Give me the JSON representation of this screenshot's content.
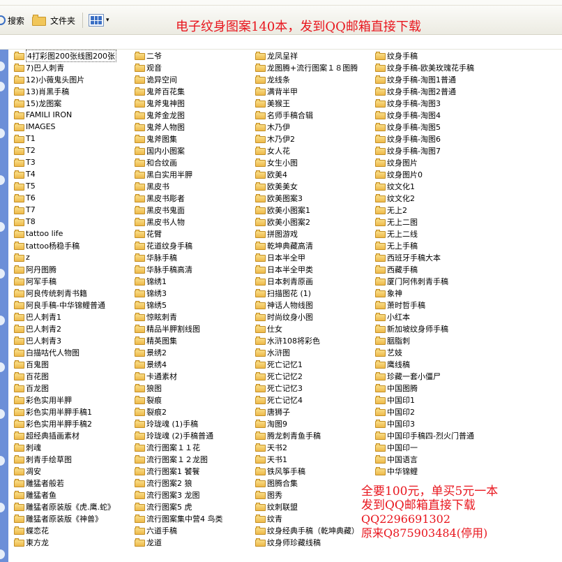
{
  "toolbar": {
    "search_label": "搜索",
    "folders_label": "文件夹",
    "banner_text": "电子纹身图案140本，发到QQ邮箱直接下载"
  },
  "promo": {
    "line1": "全要100元，单买5元一本",
    "line2": "发到QQ邮箱直接下载",
    "line3": "QQ2296691302",
    "line4": "原来Q875903484(停用)"
  },
  "colors": {
    "banner": "#e8161e",
    "sidebar": "#6c8fd8"
  },
  "files": {
    "col1": [
      "4打彩图200张线图200张",
      "7)巴人刺青",
      "12)小薇鬼头图片",
      "13)肖黑手稿",
      "15)龙图案",
      "FAMILI IRON",
      "IMAGES",
      "T1",
      "T2",
      "T3",
      "T4",
      "T5",
      "T6",
      "T7",
      "T8",
      "tattoo life",
      "tattoo杨稳手稿",
      "z",
      "阿丹图腾",
      "阿军手稿",
      "阿良传统刺青书籍",
      "阿良手稿-中华锦鲤普通",
      "巴人刺青1",
      "巴人刺青2",
      "巴人刺青3",
      "白描咕代人物图",
      "百鬼图",
      "百花图",
      "百龙图",
      "彩色实用半胛",
      "彩色实用半胛手稿1",
      "彩色实用半胛手稿2",
      "超经典插画素材",
      "刺魂",
      "刺青手绘草图",
      "凋安",
      "雕猛者般若",
      "雕猛者鱼",
      "雕猛者原装版《虎.鹰.蛇》",
      "雕猛者原装版《神兽》",
      "蝶恋花",
      "東方龙"
    ],
    "col2": [
      "二爷",
      "观音",
      "诡异空间",
      "鬼斧百花集",
      "鬼斧鬼神图",
      "鬼斧金龙图",
      "鬼斧人物图",
      "鬼斧图集",
      "国内小图案",
      "和合纹画",
      "黑白实用半胛",
      "黑皮书",
      "黑皮书彫者",
      "黑皮书鬼面",
      "黑皮书人物",
      "花臂",
      "花道纹身手稿",
      "华脉手稿",
      "华脉手稿高清",
      "锦绣1",
      "锦绣3",
      "锦绣5",
      "惊眩刺青",
      "精品半胛割线图",
      "精英图集",
      "景绣2",
      "景绣4",
      "卡通素材",
      "狼图",
      "裂痕",
      "裂痕2",
      "玲珑魂 (1)手稿",
      "玲珑魂 (2)手稿普通",
      "流行图案１１花",
      "流行图案１２龙图",
      "流行图案1 饕餮",
      "流行图案2 狼",
      "流行图案3 龙图",
      "流行图案5 虎",
      "流行图案集中营4 鸟类",
      "六道手稿",
      "龙道"
    ],
    "col3": [
      "龙凤呈祥",
      "龙图腾+流行图案１８图腾",
      "龙线条",
      "满背半甲",
      "美猴王",
      "名师手稿合辑",
      "木乃伊",
      "木乃伊2",
      "女人花",
      "女生小图",
      "欧美4",
      "欧美美女",
      "欧美图案3",
      "欧美小图案1",
      "欧美小图案2",
      "拼图游戏",
      "乾坤典藏高清",
      "日本半全甲",
      "日本半全甲类",
      "日本刺青原画",
      "扫描图花 (1)",
      "神话人物线图",
      "时尚纹身小图",
      "仕女",
      "水浒108将彩色",
      "水浒图",
      "死亡记忆1",
      "死亡记忆2",
      "死亡记忆3",
      "死亡记忆4",
      "唐狮子",
      "淘图9",
      "腾龙刺青鱼手稿",
      "天书2",
      "天书1",
      "铁风筝手稿",
      "图腾合集",
      "图秀",
      "纹刺联盟",
      "纹青",
      "纹身经典手稿（乾坤典藏）",
      "纹身师珍藏线稿"
    ],
    "col4": [
      "纹身手稿",
      "纹身手稿-欧美玫瑰花手稿",
      "纹身手稿-淘图1普通",
      "纹身手稿-淘图2普通",
      "纹身手稿-淘图3",
      "纹身手稿-淘图4",
      "纹身手稿-淘图5",
      "纹身手稿-淘图6",
      "纹身手稿-淘图7",
      "纹身图片",
      "纹身图片0",
      "纹文化1",
      "纹文化2",
      "无上2",
      "无上二图",
      "无上二线",
      "无上手稿",
      "西班牙手稿大本",
      "西藏手稿",
      "厦门阿伟刺青手稿",
      "象神",
      "萧时哲手稿",
      "小红本",
      "新加坡纹身师手稿",
      "胭脂刺",
      "艺妓",
      "鹰线稿",
      "珍藏一套小僵尸",
      "中国图腾",
      "中国印1",
      "中国印2",
      "中国印3",
      "中国印手稿四-烈火门普通",
      "中国印一",
      "中国语言",
      "中华锦鲤"
    ]
  }
}
